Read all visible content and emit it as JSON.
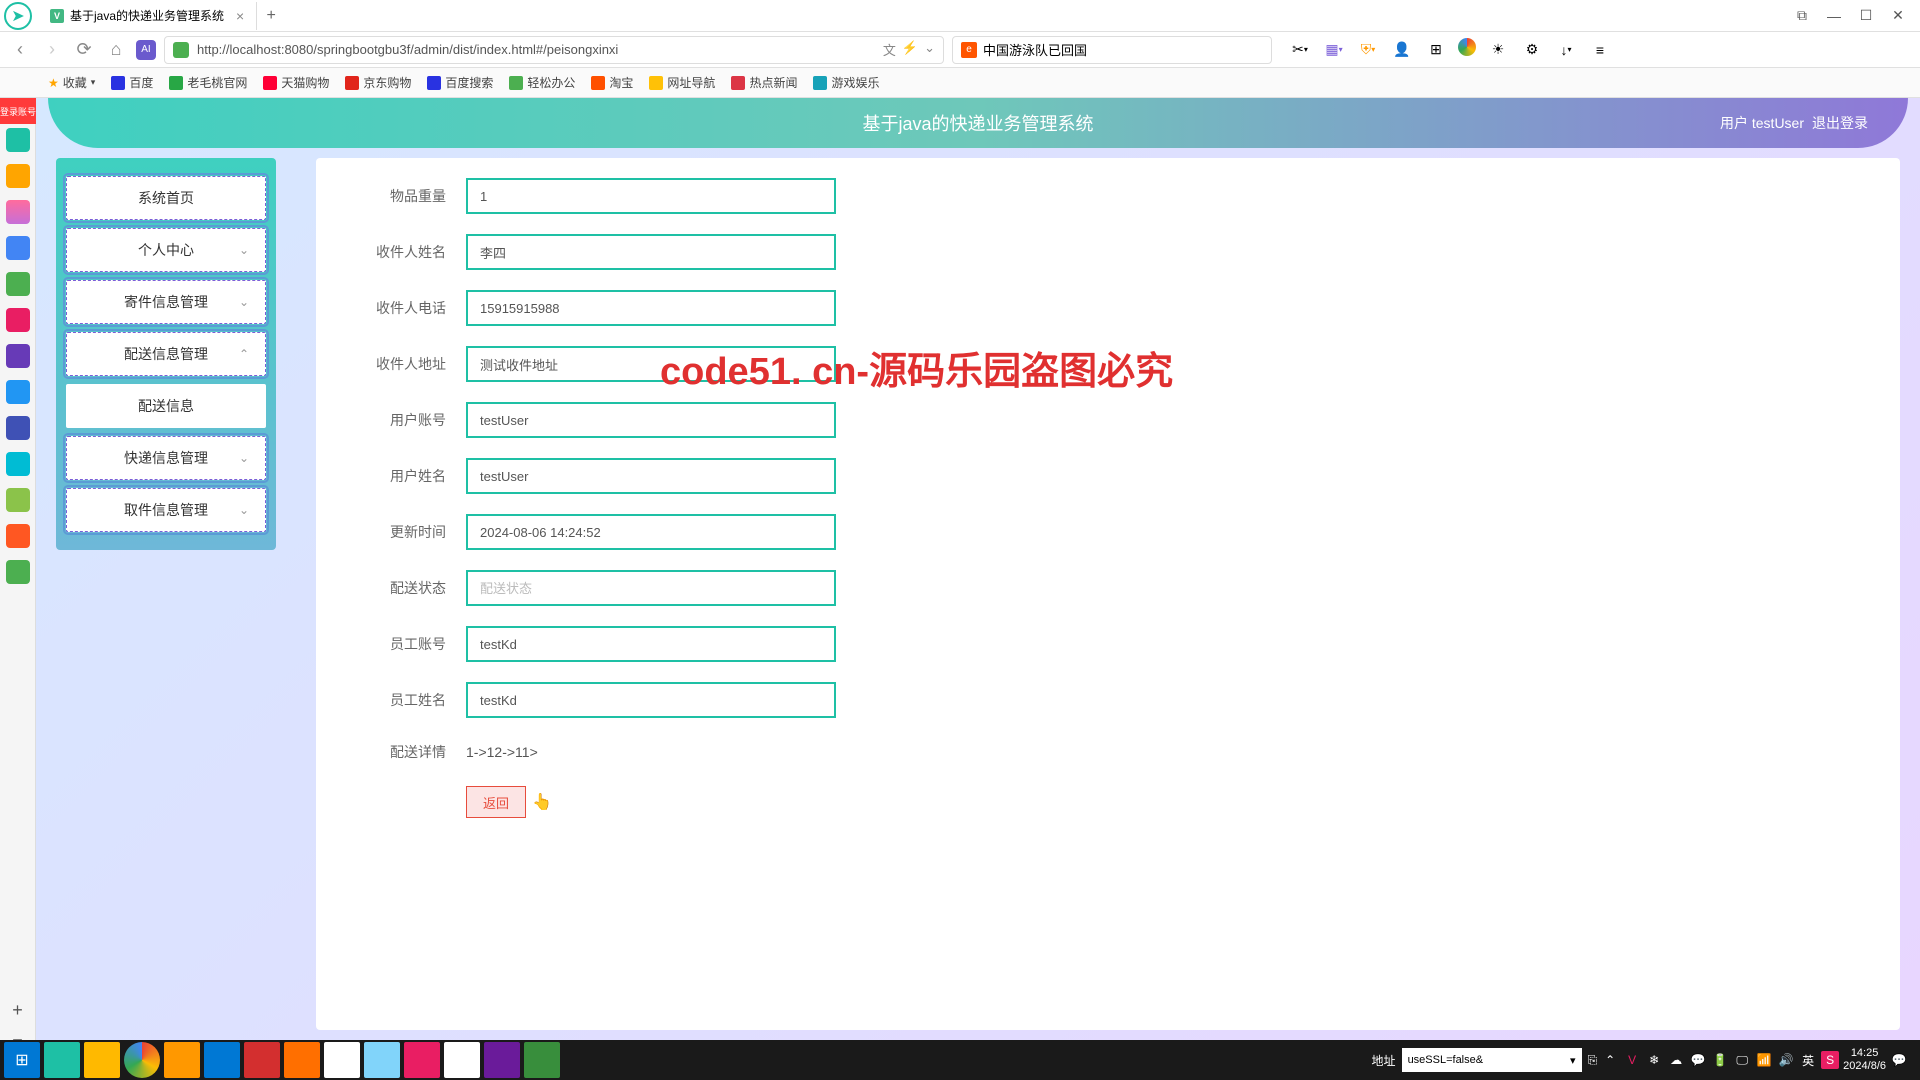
{
  "titlebar": {
    "tab_title": "基于java的快递业务管理系统",
    "close": "×",
    "add": "+"
  },
  "addrbar": {
    "url": "http://localhost:8080/springbootgbu3f/admin/dist/index.html#/peisongxinxi",
    "search": "中国游泳队已回国"
  },
  "bookmarks": {
    "fav": "收藏",
    "items": [
      "百度",
      "老毛桃官网",
      "天猫购物",
      "京东购物",
      "百度搜索",
      "轻松办公",
      "淘宝",
      "网址导航",
      "热点新闻",
      "游戏娱乐"
    ]
  },
  "leftbar_badge": "登录账号",
  "app": {
    "title": "基于java的快递业务管理系统",
    "user_label": "用户 testUser",
    "logout": "退出登录"
  },
  "menu": {
    "items": [
      {
        "label": "系统首页",
        "chev": ""
      },
      {
        "label": "个人中心",
        "chev": "⌄"
      },
      {
        "label": "寄件信息管理",
        "chev": "⌄"
      },
      {
        "label": "配送信息管理",
        "chev": "⌃"
      },
      {
        "label": "配送信息",
        "chev": "",
        "active": true
      },
      {
        "label": "快递信息管理",
        "chev": "⌄"
      },
      {
        "label": "取件信息管理",
        "chev": "⌄"
      }
    ]
  },
  "form": {
    "fields": [
      {
        "label": "物品重量",
        "value": "1"
      },
      {
        "label": "收件人姓名",
        "value": "李四"
      },
      {
        "label": "收件人电话",
        "value": "15915915988"
      },
      {
        "label": "收件人地址",
        "value": "测试收件地址"
      },
      {
        "label": "用户账号",
        "value": "testUser"
      },
      {
        "label": "用户姓名",
        "value": "testUser"
      },
      {
        "label": "更新时间",
        "value": "2024-08-06 14:24:52"
      },
      {
        "label": "配送状态",
        "value": "",
        "placeholder": "配送状态"
      },
      {
        "label": "员工账号",
        "value": "testKd"
      },
      {
        "label": "员工姓名",
        "value": "testKd"
      }
    ],
    "detail": {
      "label": "配送详情",
      "value": "1->12->11>"
    },
    "back": "返回"
  },
  "watermark": "code51. cn-源码乐园盗图必究",
  "taskbar": {
    "addr_label": "地址",
    "addr_value": "useSSL=false&",
    "time": "14:25",
    "date": "2024/8/6"
  }
}
